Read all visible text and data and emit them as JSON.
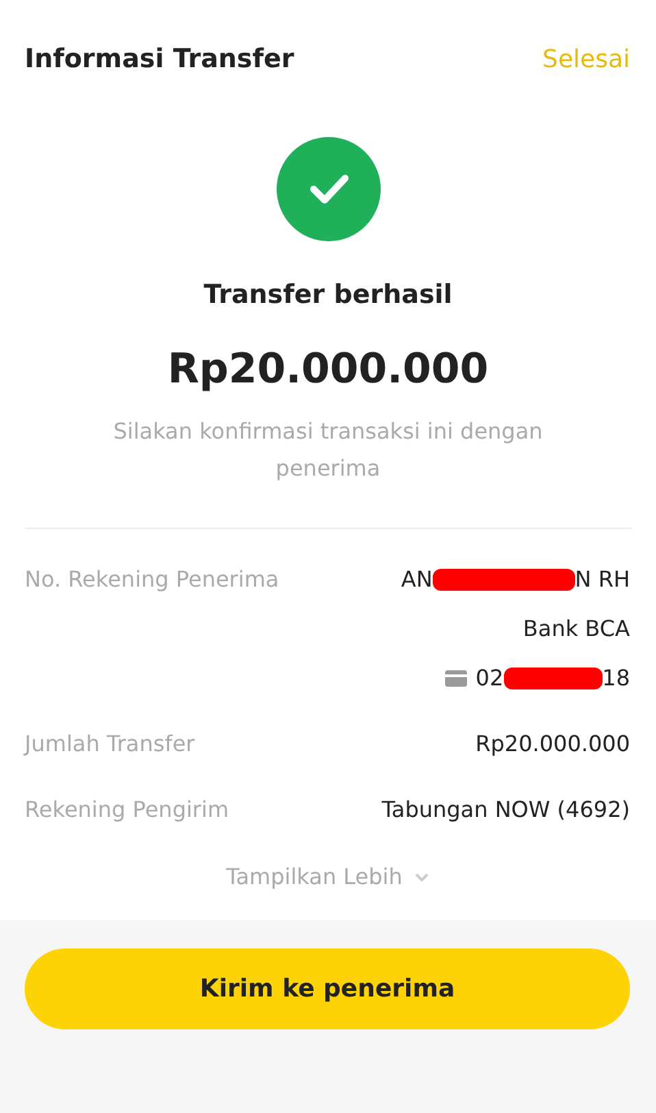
{
  "header": {
    "title": "Informasi Transfer",
    "action": "Selesai"
  },
  "status": {
    "title": "Transfer berhasil",
    "amount": "Rp20.000.000",
    "message": "Silakan konfirmasi transaksi ini dengan penerima"
  },
  "details": [
    {
      "kind": "recipient",
      "label": "No. Rekening Penerima",
      "name_parts": [
        "AN",
        "N RH"
      ],
      "bank": "Bank BCA",
      "account_parts": [
        "02",
        "18"
      ]
    },
    {
      "kind": "plain",
      "label": "Jumlah Transfer",
      "value": "Rp20.000.000"
    },
    {
      "kind": "plain",
      "label": "Rekening Pengirim",
      "value": "Tabungan NOW (4692)"
    }
  ],
  "show_more": "Tampilkan Lebih",
  "primary_button": "Kirim ke penerima"
}
